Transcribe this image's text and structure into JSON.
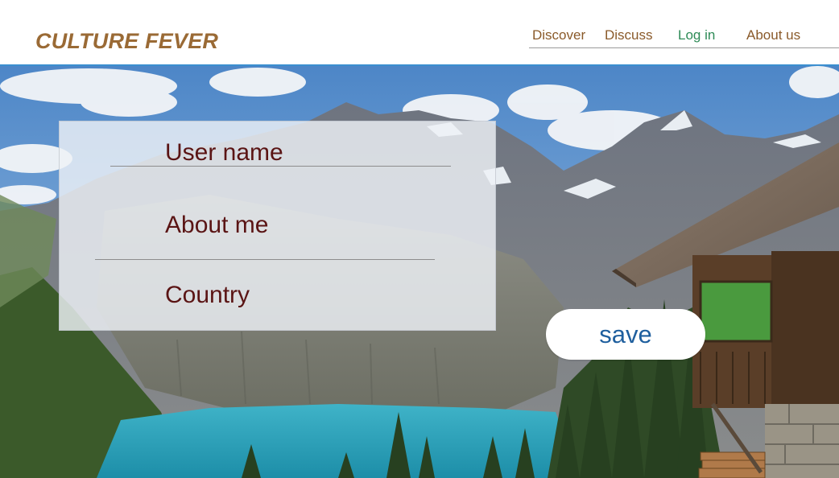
{
  "header": {
    "logo": "CULTURE FEVER",
    "nav": [
      {
        "label": "Discover"
      },
      {
        "label": "Discuss"
      },
      {
        "label": "Log in"
      },
      {
        "label": "About us"
      }
    ]
  },
  "form": {
    "fields": [
      {
        "label": "User name"
      },
      {
        "label": "About me"
      },
      {
        "label": "Country"
      }
    ],
    "save_label": "save"
  },
  "colors": {
    "brand": "#9a6a35",
    "nav_text": "#8a5a2a",
    "login_text": "#2e8b57",
    "header_border": "#3b8fd0",
    "field_label": "#5a1414",
    "save_text": "#1f5f9e"
  }
}
